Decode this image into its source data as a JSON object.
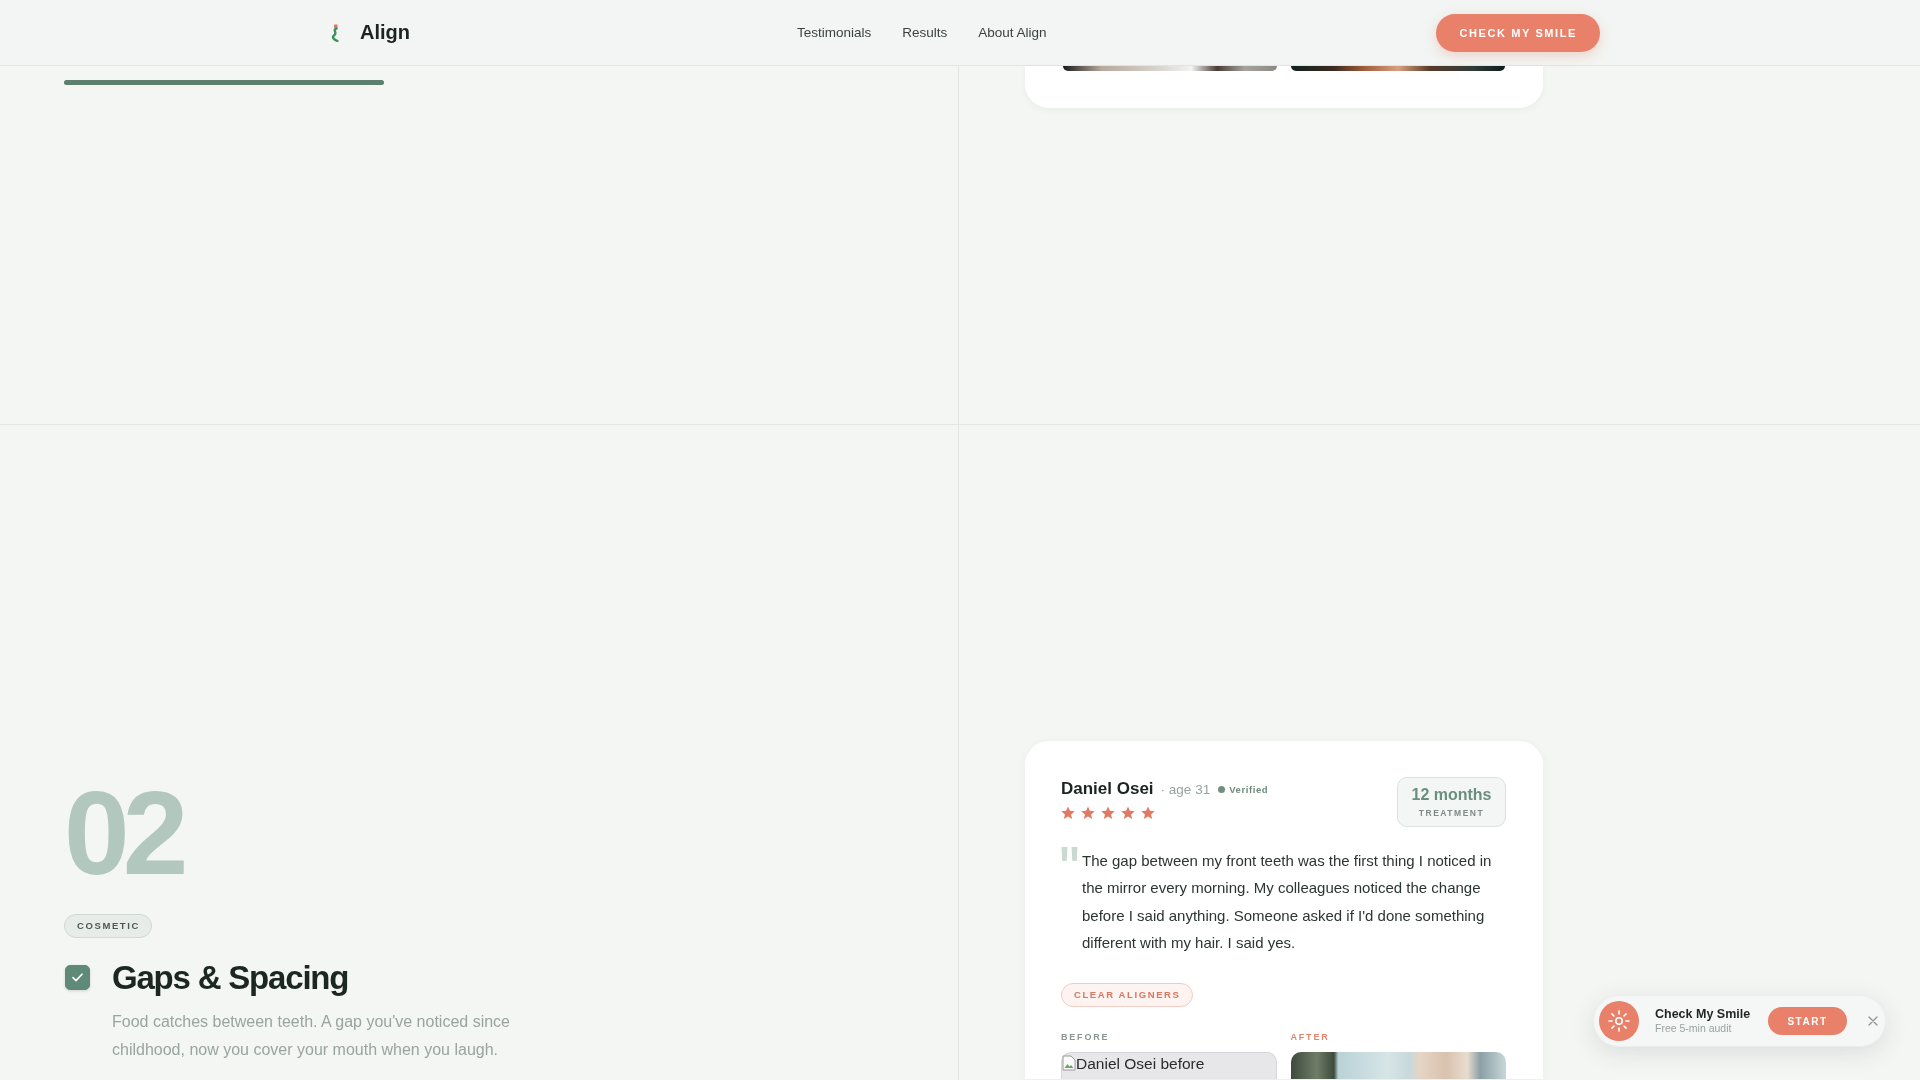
{
  "header": {
    "brand": "Align",
    "nav": [
      {
        "label": "Testimonials"
      },
      {
        "label": "Results"
      },
      {
        "label": "About Align"
      }
    ],
    "cta": "CHECK MY SMILE"
  },
  "previous_section": {
    "progress": {
      "level": 1
    }
  },
  "condition": {
    "number": "02",
    "tag": "COSMETIC",
    "checked": true,
    "title": "Gaps & Spacing",
    "description": "Food catches between teeth. A gap you've noticed since childhood, now you cover your mouth when you laugh.",
    "review": {
      "name": "Daniel Osei",
      "age": "· age 31",
      "verified": "Verified",
      "stars": 5,
      "duration": "12 months",
      "duration_label": "TREATMENT",
      "quote": "The gap between my front teeth was the first thing I noticed in the mirror every morning. My colleagues noticed the change before I said anything. Someone asked if I'd done something different with my hair. I said yes.",
      "treatment_tag": "CLEAR ALIGNERS",
      "before_label": "BEFORE",
      "before_alt": "Daniel Osei before",
      "after_label": "AFTER"
    }
  },
  "widget": {
    "title": "Check My Smile",
    "subtitle": "Free 5-min audit",
    "button": "START"
  }
}
